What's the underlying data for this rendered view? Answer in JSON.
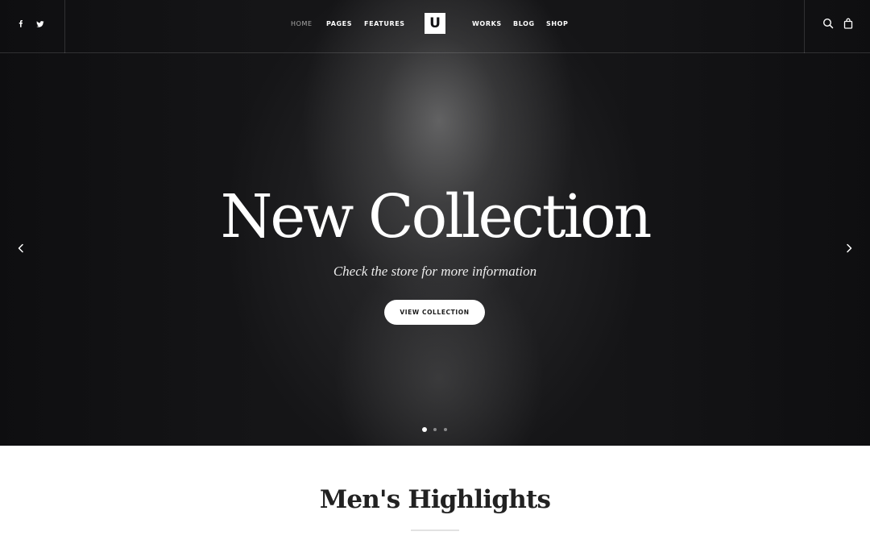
{
  "header": {
    "social": [
      "facebook-icon",
      "twitter-icon"
    ],
    "nav_left": [
      {
        "label": "HOME",
        "active": true
      },
      {
        "label": "PAGES",
        "active": false
      },
      {
        "label": "FEATURES",
        "active": false
      }
    ],
    "logo": "U",
    "nav_right": [
      {
        "label": "WORKS",
        "active": false
      },
      {
        "label": "BLOG",
        "active": false
      },
      {
        "label": "SHOP",
        "active": false
      }
    ],
    "tools": [
      "search-icon",
      "shopping-bag-icon"
    ]
  },
  "hero": {
    "title": "New Collection",
    "subtitle": "Check the store for more information",
    "cta_label": "VIEW COLLECTION",
    "slides_total": 3,
    "active_slide": 1
  },
  "section": {
    "title": "Men's Highlights"
  },
  "colors": {
    "hero_bg": "#151517",
    "text_light": "#ffffff",
    "nav_active": "#a9a9a9",
    "heading_dark": "#222222"
  }
}
